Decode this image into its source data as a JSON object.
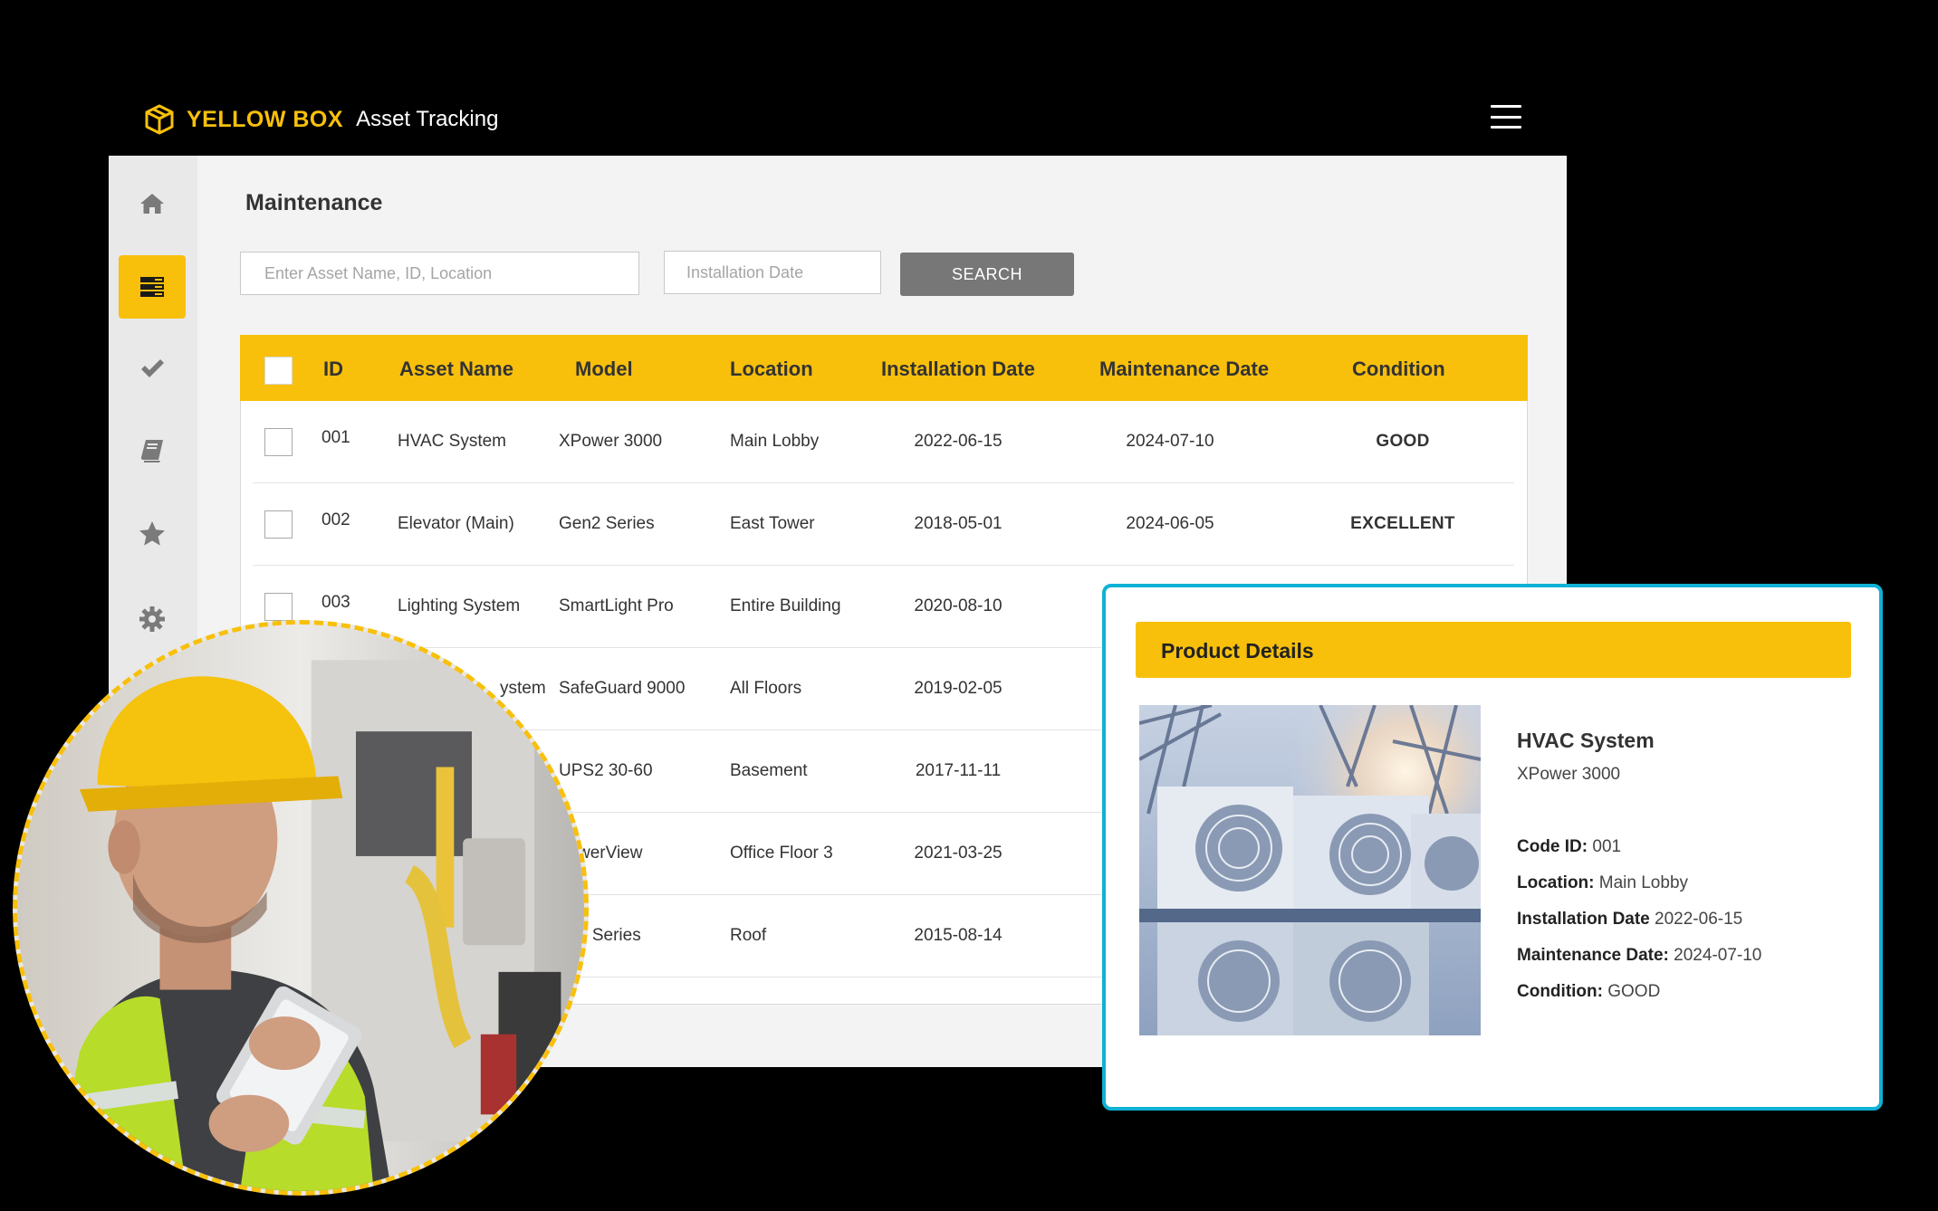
{
  "brand": {
    "name": "YELLOW BOX",
    "subtitle": "Asset Tracking",
    "accent": "#f8c00b"
  },
  "sidebar": {
    "items": [
      {
        "icon": "home-icon",
        "active": false
      },
      {
        "icon": "server-list-icon",
        "active": true
      },
      {
        "icon": "check-icon",
        "active": false
      },
      {
        "icon": "book-icon",
        "active": false
      },
      {
        "icon": "star-icon",
        "active": false
      },
      {
        "icon": "gear-icon",
        "active": false
      }
    ]
  },
  "page": {
    "title": "Maintenance"
  },
  "search": {
    "placeholder": "Enter Asset Name, ID, Location",
    "date_placeholder": "Installation Date",
    "button_label": "SEARCH"
  },
  "table": {
    "headers": {
      "id": "ID",
      "asset": "Asset Name",
      "model": "Model",
      "location": "Location",
      "install": "Installation Date",
      "maint": "Maintenance Date",
      "condition": "Condition"
    },
    "rows": [
      {
        "id": "001",
        "asset": "HVAC System",
        "model": "XPower 3000",
        "location": "Main Lobby",
        "install": "2022-06-15",
        "maint": "2024-07-10",
        "condition": "GOOD"
      },
      {
        "id": "002",
        "asset": "Elevator (Main)",
        "model": "Gen2 Series",
        "location": "East Tower",
        "install": "2018-05-01",
        "maint": "2024-06-05",
        "condition": "EXCELLENT"
      },
      {
        "id": "003",
        "asset": "Lighting System",
        "model": "SmartLight Pro",
        "location": "Entire Building",
        "install": "2020-08-10"
      },
      {
        "asset": "ystem",
        "model": "SafeGuard 9000",
        "location": "All Floors",
        "install": "2019-02-05"
      },
      {
        "model": "UPS2 30-60",
        "location": "Basement",
        "install": "2017-11-11"
      },
      {
        "model": "werView",
        "location": "Office Floor 3",
        "install": "2021-03-25"
      },
      {
        "model": "0 Series",
        "location": "Roof",
        "install": "2015-08-14"
      }
    ]
  },
  "details": {
    "title": "Product Details",
    "name": "HVAC System",
    "model": "XPower 3000",
    "code_label": "Code ID:",
    "code": "001",
    "location_label": "Location:",
    "location": "Main Lobby",
    "install_label": "Installation Date",
    "install": "2022-06-15",
    "maint_label": "Maintenance Date:",
    "maint": "2024-07-10",
    "condition_label": "Condition:",
    "condition": "GOOD",
    "border_color": "#10b1d6"
  }
}
